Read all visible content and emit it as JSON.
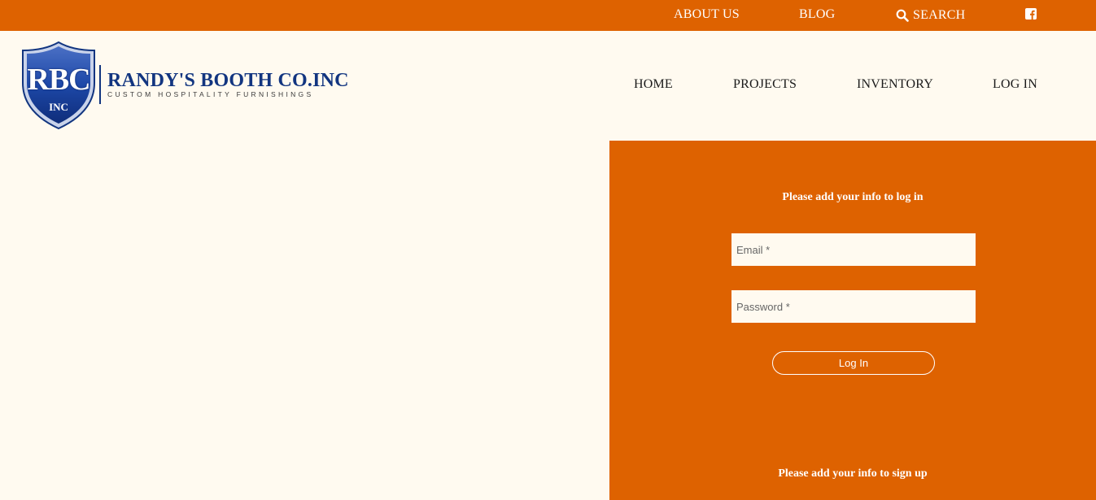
{
  "topbar": {
    "about_label": "ABOUT US",
    "blog_label": "BLOG",
    "search_label": "SEARCH",
    "facebook_icon": "facebook-icon",
    "background_color": "#de6200"
  },
  "brand": {
    "emblem_letters": "RBC",
    "emblem_sub": "INC",
    "name": "RANDY'S BOOTH CO.INC",
    "tagline": "CUSTOM HOSPITALITY FURNISHINGS",
    "primary_color": "#123580"
  },
  "nav": {
    "items": [
      {
        "label": "HOME"
      },
      {
        "label": "PROJECTS"
      },
      {
        "label": "INVENTORY"
      },
      {
        "label": "LOG IN"
      }
    ]
  },
  "login": {
    "heading": "Please add your info to log in",
    "email_placeholder": "Email *",
    "email_value": "",
    "password_placeholder": "Password *",
    "password_value": "",
    "button_label": "Log In",
    "signup_heading": "Please add your info to sign up",
    "panel_color": "#de6200"
  },
  "page": {
    "background_color": "#fffaf0"
  }
}
